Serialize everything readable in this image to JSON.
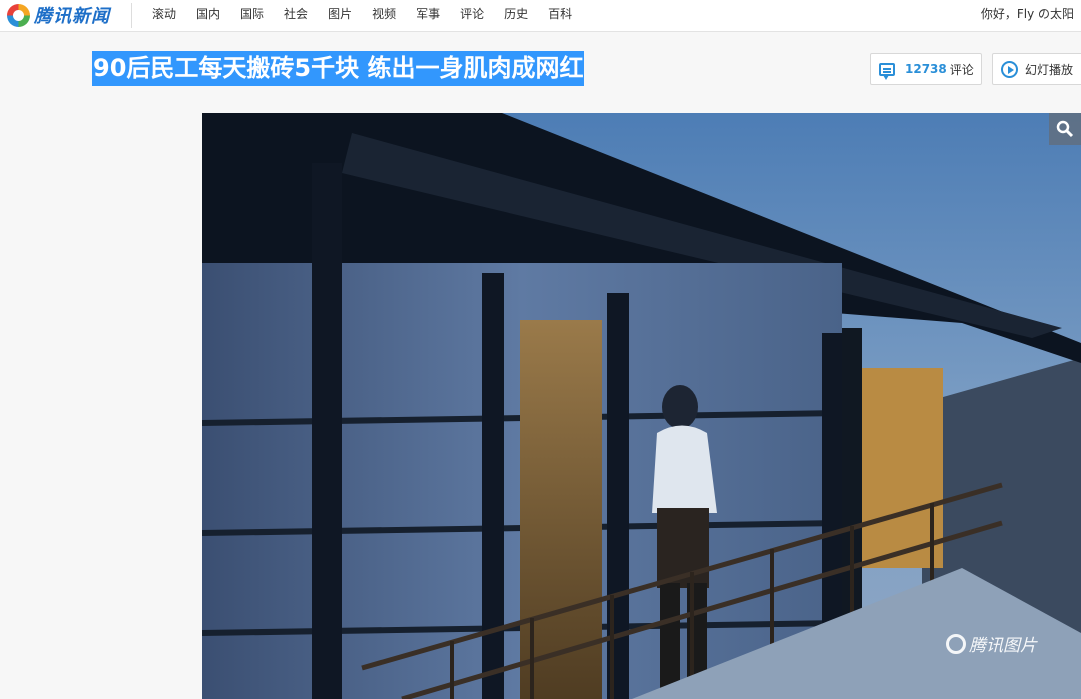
{
  "header": {
    "logo_text": "腾讯新闻",
    "nav": [
      "滚动",
      "国内",
      "国际",
      "社会",
      "图片",
      "视频",
      "军事",
      "评论",
      "历史",
      "百科"
    ],
    "user_greeting": "你好，Fly の太阳"
  },
  "article": {
    "title": "90后民工每天搬砖5千块 练出一身肌肉成网红"
  },
  "actions": {
    "comment_count": "12738",
    "comment_label": "评论",
    "slideshow_label": "幻灯播放"
  },
  "photo": {
    "watermark": "腾讯图片"
  },
  "icons": {
    "logo": "tencent-logo-icon",
    "comment": "comment-icon",
    "play": "play-icon",
    "zoom": "search-icon"
  },
  "colors": {
    "accent": "#2a8fd8",
    "title_highlight": "#3297fd"
  }
}
